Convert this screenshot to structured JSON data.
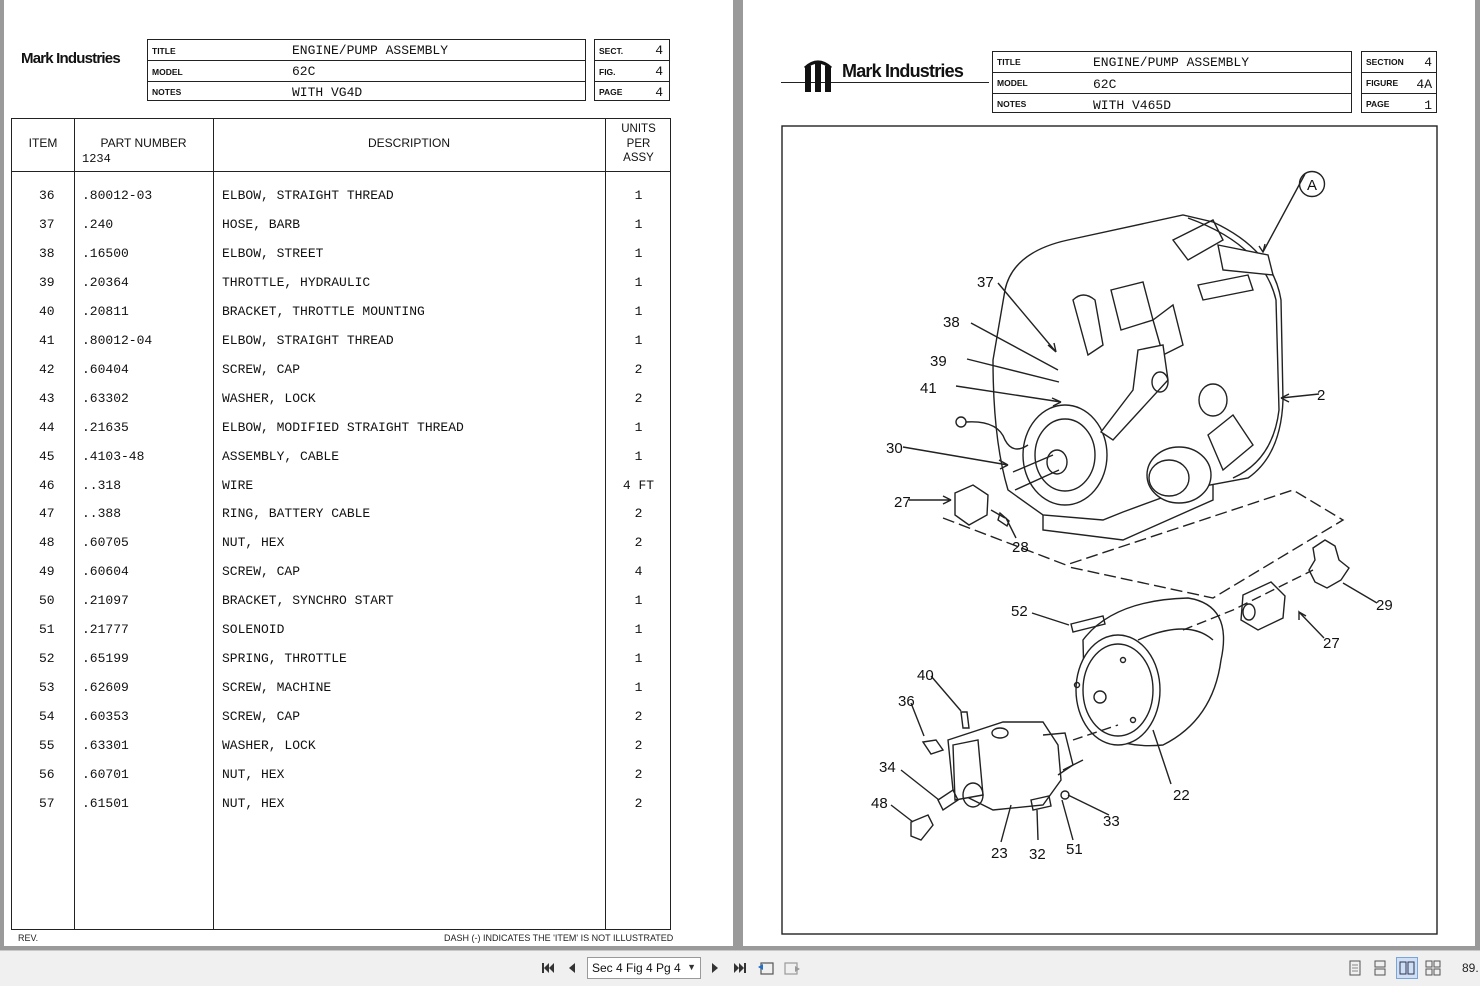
{
  "toolbar": {
    "page_selector": "Sec 4 Fig 4 Pg 4",
    "zoom": "89."
  },
  "left_page": {
    "brand": "Mark Industries",
    "header": {
      "title_label": "TITLE",
      "title": "ENGINE/PUMP ASSEMBLY",
      "model_label": "MODEL",
      "model": "62C",
      "notes_label": "NOTES",
      "notes": "WITH VG4D",
      "sect_label": "SECT.",
      "sect": "4",
      "fig_label": "FIG.",
      "fig": "4",
      "page_label": "PAGE",
      "page": "4"
    },
    "columns": {
      "item": "ITEM",
      "part_number": "PART NUMBER",
      "part_sub": "1234",
      "description": "DESCRIPTION",
      "units": [
        "UNITS",
        "PER",
        "ASSY"
      ]
    },
    "rows": [
      {
        "item": "36",
        "part": ".80012-03",
        "desc": "ELBOW, STRAIGHT THREAD",
        "qty": "1"
      },
      {
        "item": "37",
        "part": ".240",
        "desc": "HOSE, BARB",
        "qty": "1"
      },
      {
        "item": "38",
        "part": ".16500",
        "desc": "ELBOW, STREET",
        "qty": "1"
      },
      {
        "item": "39",
        "part": ".20364",
        "desc": "THROTTLE, HYDRAULIC",
        "qty": "1"
      },
      {
        "item": "40",
        "part": ".20811",
        "desc": "BRACKET, THROTTLE MOUNTING",
        "qty": "1"
      },
      {
        "item": "41",
        "part": ".80012-04",
        "desc": "ELBOW, STRAIGHT THREAD",
        "qty": "1"
      },
      {
        "item": "42",
        "part": ".60404",
        "desc": "SCREW, CAP",
        "qty": "2"
      },
      {
        "item": "43",
        "part": ".63302",
        "desc": "WASHER, LOCK",
        "qty": "2"
      },
      {
        "item": "44",
        "part": ".21635",
        "desc": "ELBOW, MODIFIED STRAIGHT THREAD",
        "qty": "1"
      },
      {
        "item": "45",
        "part": ".4103-48",
        "desc": "ASSEMBLY, CABLE",
        "qty": "1"
      },
      {
        "item": "46",
        "part": "..318",
        "desc": "WIRE",
        "qty": "4 FT"
      },
      {
        "item": "47",
        "part": "..388",
        "desc": "RING, BATTERY CABLE",
        "qty": "2"
      },
      {
        "item": "48",
        "part": ".60705",
        "desc": "NUT, HEX",
        "qty": "2"
      },
      {
        "item": "49",
        "part": ".60604",
        "desc": "SCREW, CAP",
        "qty": "4"
      },
      {
        "item": "50",
        "part": ".21097",
        "desc": "BRACKET, SYNCHRO START",
        "qty": "1"
      },
      {
        "item": "51",
        "part": ".21777",
        "desc": "SOLENOID",
        "qty": "1"
      },
      {
        "item": "52",
        "part": ".65199",
        "desc": "SPRING, THROTTLE",
        "qty": "1"
      },
      {
        "item": "53",
        "part": ".62609",
        "desc": "SCREW, MACHINE",
        "qty": "1"
      },
      {
        "item": "54",
        "part": ".60353",
        "desc": "SCREW, CAP",
        "qty": "2"
      },
      {
        "item": "55",
        "part": ".63301",
        "desc": "WASHER, LOCK",
        "qty": "2"
      },
      {
        "item": "56",
        "part": ".60701",
        "desc": "NUT, HEX",
        "qty": "2"
      },
      {
        "item": "57",
        "part": ".61501",
        "desc": "NUT, HEX",
        "qty": "2"
      }
    ],
    "footer_rev": "REV.",
    "footer_note": "DASH (-) INDICATES THE 'ITEM' IS NOT ILLUSTRATED"
  },
  "right_page": {
    "brand": "Mark Industries",
    "header": {
      "title_label": "TITLE",
      "title": "ENGINE/PUMP ASSEMBLY",
      "model_label": "MODEL",
      "model": "62C",
      "notes_label": "NOTES",
      "notes": "WITH V465D",
      "section_label": "SECTION",
      "section": "4",
      "figure_label": "FIGURE",
      "figure": "4A",
      "page_label": "PAGE",
      "page": "1"
    },
    "callouts": {
      "A": "A",
      "c2": "2",
      "c22": "22",
      "c23": "23",
      "c27a": "27",
      "c27b": "27",
      "c28": "28",
      "c29": "29",
      "c30": "30",
      "c32": "32",
      "c33": "33",
      "c34": "34",
      "c36": "36",
      "c37": "37",
      "c38": "38",
      "c39": "39",
      "c40": "40",
      "c41": "41",
      "c48": "48",
      "c51": "51",
      "c52": "52"
    }
  }
}
